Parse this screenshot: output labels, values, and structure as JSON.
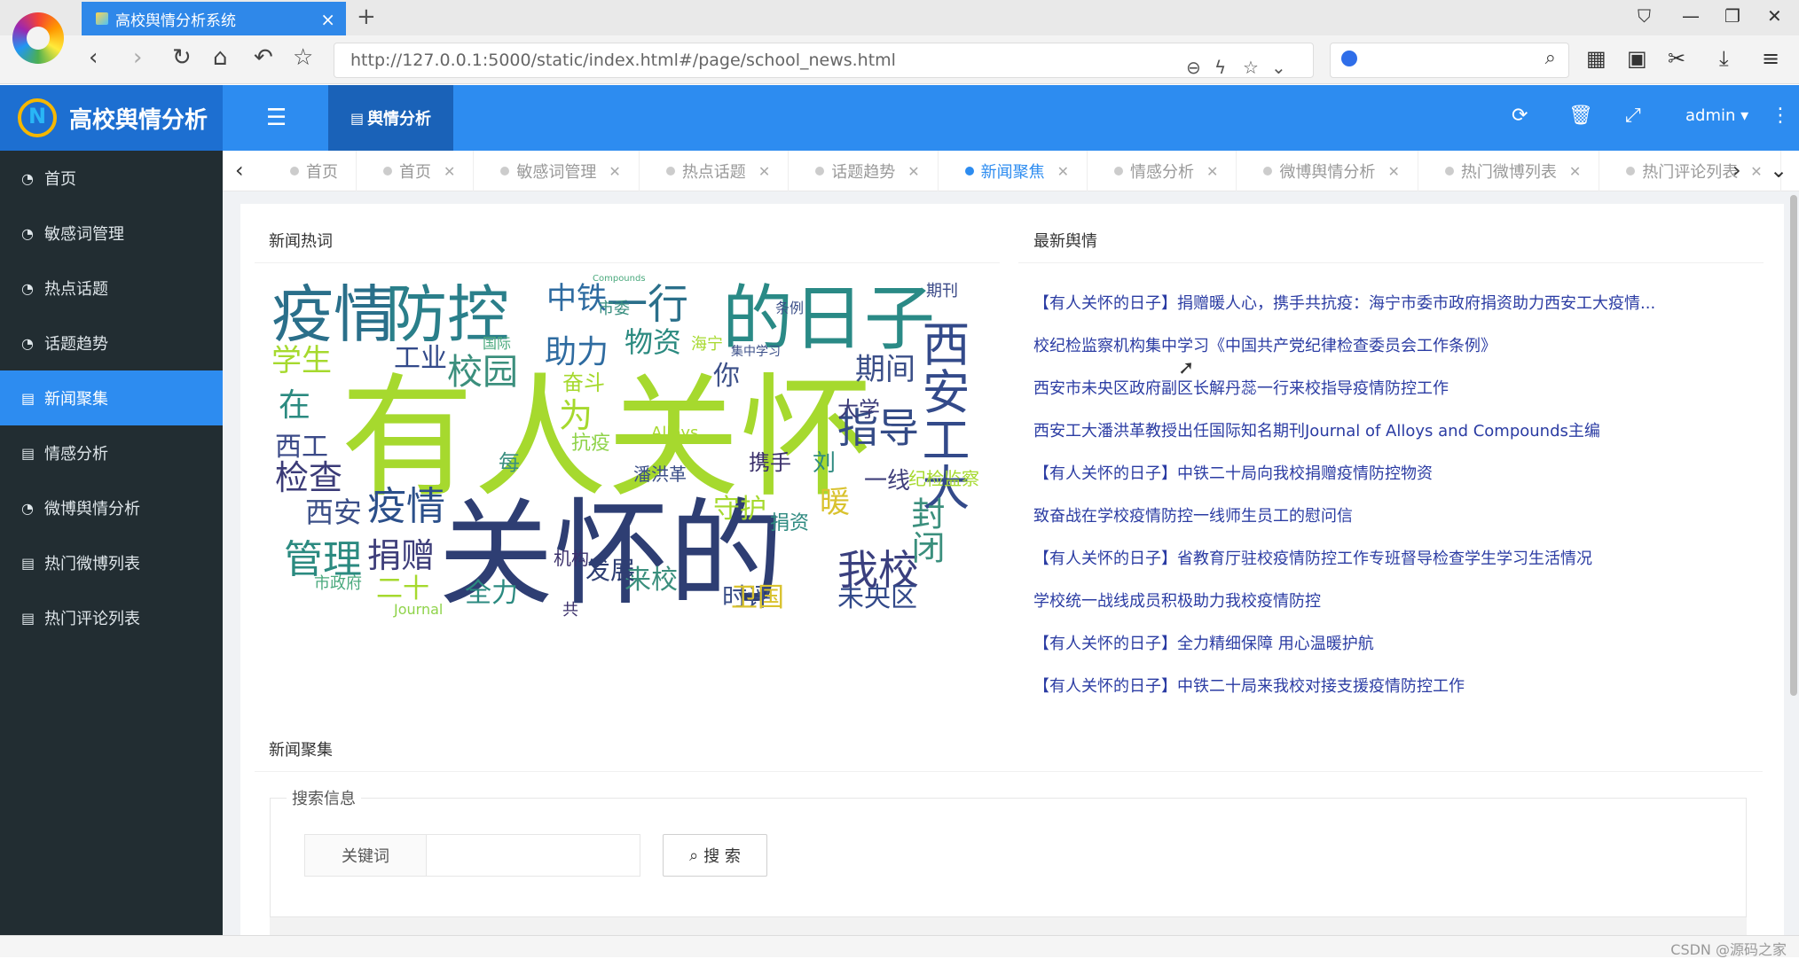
{
  "browser": {
    "tab_title": "高校舆情分析系统",
    "url": "http://127.0.0.1:5000/static/index.html#/page/school_news.html"
  },
  "header": {
    "brand": "高校舆情分析",
    "module": "舆情分析",
    "user": "admin ▾"
  },
  "sidebar": {
    "items": [
      {
        "label": "首页",
        "icon": "dashboard-icon"
      },
      {
        "label": "敏感词管理",
        "icon": "dashboard-icon"
      },
      {
        "label": "热点话题",
        "icon": "dashboard-icon"
      },
      {
        "label": "话题趋势",
        "icon": "dashboard-icon"
      },
      {
        "label": "新闻聚集",
        "icon": "file-icon"
      },
      {
        "label": "情感分析",
        "icon": "file-icon"
      },
      {
        "label": "微博舆情分析",
        "icon": "dashboard-icon"
      },
      {
        "label": "热门微博列表",
        "icon": "file-icon"
      },
      {
        "label": "热门评论列表",
        "icon": "file-icon"
      }
    ]
  },
  "page_tabs": [
    "首页",
    "首页",
    "敏感词管理",
    "热点话题",
    "话题趋势",
    "新闻聚焦",
    "情感分析",
    "微博舆情分析",
    "热门微博列表",
    "热门评论列表"
  ],
  "hot_words": {
    "title": "新闻热词",
    "words": [
      "有人关怀",
      "关怀的",
      "疫情",
      "防控",
      "的日子",
      "一行",
      "中铁",
      "西安工大",
      "指导",
      "物资",
      "助力",
      "学生",
      "工业",
      "期间",
      "校园",
      "在",
      "为",
      "西工",
      "检查",
      "疫情",
      "西安",
      "管理",
      "捐赠",
      "二十",
      "我校",
      "封闭",
      "暖",
      "来校",
      "发展",
      "全力",
      "时评",
      "未央区",
      "卫国",
      "守护",
      "携手",
      "刘",
      "一线",
      "纪检监察",
      "大学",
      "奋斗",
      "抗疫",
      "潘洪革",
      "每",
      "你",
      "机构",
      "市政府",
      "Journal",
      "Alloys",
      "Compounds",
      "国际",
      "海宁",
      "集中学习",
      "期刊",
      "条例",
      "捐资",
      "市委",
      "共"
    ]
  },
  "latest": {
    "title": "最新舆情",
    "items": [
      "【有人关怀的日子】捐赠暖人心，携手共抗疫：海宁市委市政府捐资助力西安工大疫情...",
      "校纪检监察机构集中学习《中国共产党纪律检查委员会工作条例》",
      "西安市未央区政府副区长解丹蕊一行来校指导疫情防控工作",
      "西安工大潘洪革教授出任国际知名期刊Journal of Alloys and Compounds主编",
      "【有人关怀的日子】中铁二十局向我校捐赠疫情防控物资",
      "致奋战在学校疫情防控一线师生员工的慰问信",
      "【有人关怀的日子】省教育厅驻校疫情防控工作专班督导检查学生学习生活情况",
      "学校统一战线成员积极助力我校疫情防控",
      "【有人关怀的日子】全力精细保障 用心温暖护航",
      "【有人关怀的日子】中铁二十局来我校对接支援疫情防控工作"
    ]
  },
  "news_cluster": {
    "title": "新闻聚集",
    "legend": "搜索信息",
    "keyword_label": "关键词",
    "keyword_value": "",
    "search_label": "搜 索"
  },
  "footer": {
    "watermark": "CSDN @源码之家"
  },
  "colors": {
    "primary": "#2d8cf0",
    "sidebar": "#222d32",
    "link": "#2b3ca3"
  }
}
